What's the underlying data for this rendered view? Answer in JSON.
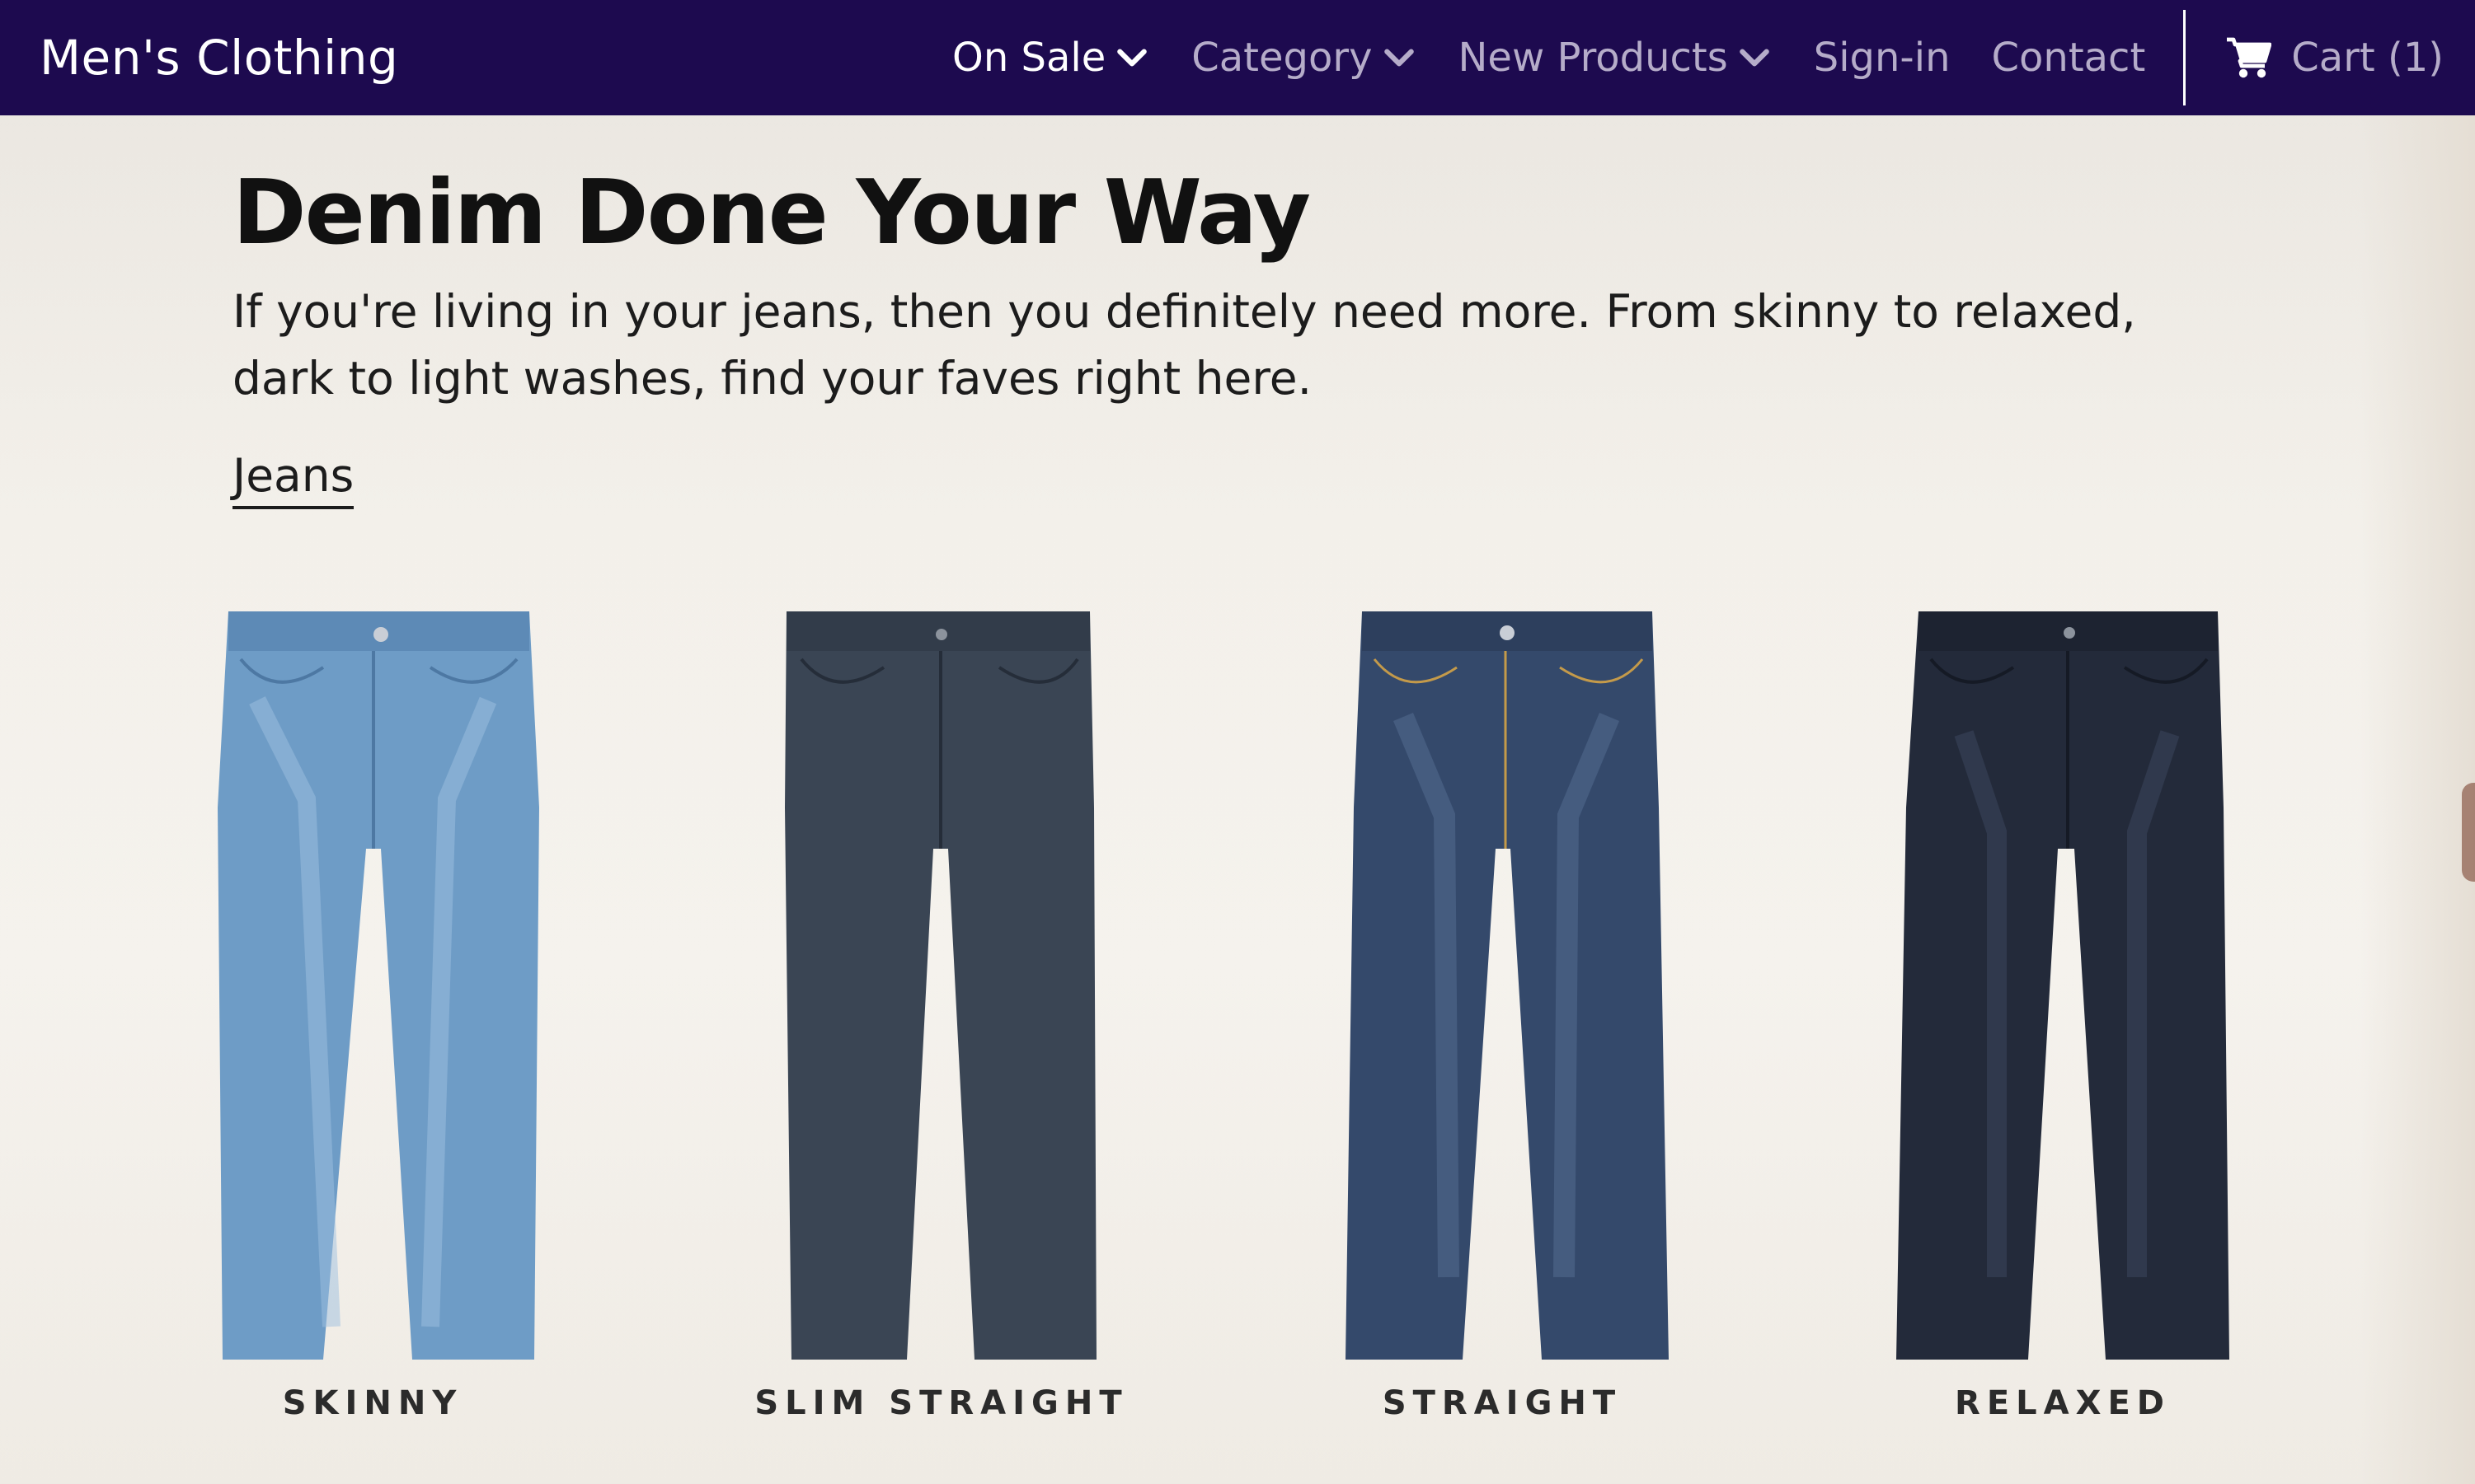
{
  "navbar": {
    "brand": "Men's Clothing",
    "items": [
      {
        "label": "On Sale",
        "has_dropdown": true,
        "active": true
      },
      {
        "label": "Category",
        "has_dropdown": true,
        "active": false
      },
      {
        "label": "New Products",
        "has_dropdown": true,
        "active": false
      },
      {
        "label": "Sign-in",
        "has_dropdown": false,
        "active": false
      },
      {
        "label": "Contact",
        "has_dropdown": false,
        "active": false
      }
    ],
    "cart_label": "Cart (1)",
    "cart_icon": "shopping-cart-icon",
    "chevron_icon": "chevron-down-icon"
  },
  "hero": {
    "title": "Denim Done Your Way",
    "description": "If you're living in your jeans, then you definitely need more. From skinny to relaxed, dark to light washes, find your faves right here.",
    "link": "Jeans"
  },
  "products": [
    {
      "label": "SKINNY",
      "color": "#6e9cc6"
    },
    {
      "label": "SLIM STRAIGHT",
      "color": "#3a4554"
    },
    {
      "label": "STRAIGHT",
      "color": "#34496b"
    },
    {
      "label": "RELAXED",
      "color": "#232a3a"
    }
  ],
  "colors": {
    "navbar_bg": "#1d0a4f",
    "nav_text": "#b5acc9",
    "nav_active": "#ffffff"
  }
}
